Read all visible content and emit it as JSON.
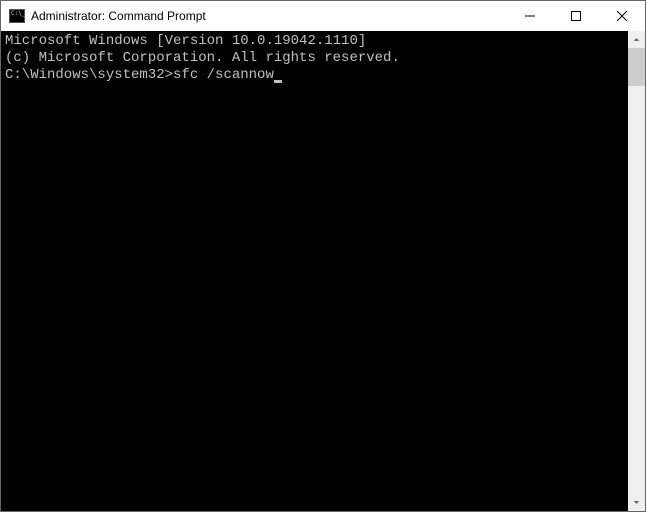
{
  "window": {
    "title": "Administrator: Command Prompt"
  },
  "console": {
    "line1": "Microsoft Windows [Version 10.0.19042.1110]",
    "line2": "(c) Microsoft Corporation. All rights reserved.",
    "blank": "",
    "prompt": "C:\\Windows\\system32>",
    "input": "sfc /scannow"
  }
}
